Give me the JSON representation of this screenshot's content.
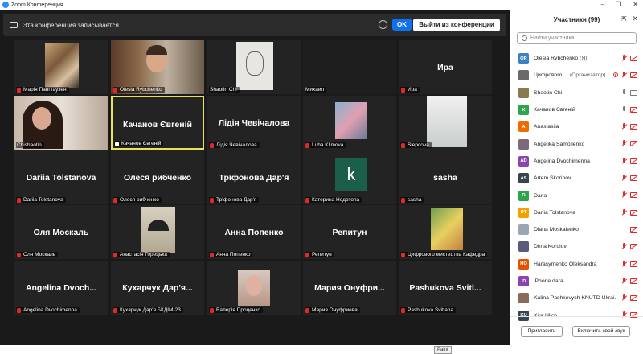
{
  "window": {
    "title": "Zoom Конференция",
    "minimize": "–",
    "restore": "❐",
    "close": "✕"
  },
  "recording_bar": {
    "message": "Эта конференция записывается.",
    "info_icon": "i",
    "ok_label": "OK",
    "leave_label": "Выйти из конференции"
  },
  "tiles": [
    {
      "caption": "Марія Пангтаузен",
      "big": "",
      "mic": "muted",
      "video": "photo-colorful"
    },
    {
      "caption": "Olesia Rybchenko",
      "big": "",
      "mic": "muted",
      "video": "woman-shelf"
    },
    {
      "caption": "Shaotin Chi",
      "big": "",
      "mic": "none",
      "video": "sketch"
    },
    {
      "caption": "Михаил",
      "big": "",
      "mic": "none",
      "video": "dark"
    },
    {
      "caption": "Ира",
      "big": "Ира",
      "mic": "muted",
      "video": ""
    },
    {
      "caption": "Chishaotin",
      "big": "",
      "mic": "none",
      "video": "woman-bright"
    },
    {
      "caption": "Качанов Євгеній",
      "big": "Качанов Євгеній",
      "mic": "on",
      "video": "",
      "active": true
    },
    {
      "caption": "Лідія Чевічалова",
      "big": "Лідія Чевічалова",
      "mic": "muted",
      "video": ""
    },
    {
      "caption": "Luba Klimova",
      "big": "",
      "mic": "muted",
      "video": "cartoon"
    },
    {
      "caption": "Slepcova",
      "big": "",
      "mic": "muted",
      "video": "light-panel"
    },
    {
      "caption": "Dariia Tolstanova",
      "big": "Dariia Tolstanova",
      "mic": "muted",
      "video": ""
    },
    {
      "caption": "Олеся рибченко",
      "big": "Олеся рибченко",
      "mic": "muted",
      "video": ""
    },
    {
      "caption": "Трїфонова Дар'я",
      "big": "Трїфонова Дар'я",
      "mic": "muted",
      "video": ""
    },
    {
      "caption": "Катерина Недотопа",
      "big": "",
      "mic": "muted",
      "video": "k-avatar",
      "avatar_letter": "k"
    },
    {
      "caption": "sasha",
      "big": "sasha",
      "mic": "muted",
      "video": ""
    },
    {
      "caption": "Оля Москаль",
      "big": "Оля Москаль",
      "mic": "muted",
      "video": ""
    },
    {
      "caption": "Анастасія Горецька",
      "big": "",
      "mic": "muted",
      "video": "photo-umbrella"
    },
    {
      "caption": "Анна Попенко",
      "big": "Анна Попенко",
      "mic": "muted",
      "video": ""
    },
    {
      "caption": "Репитун",
      "big": "Репитун",
      "mic": "muted",
      "video": ""
    },
    {
      "caption": "Цифрового мистецтва Кафедра",
      "big": "",
      "mic": "muted",
      "video": "photo-phone"
    },
    {
      "caption": "Angelina Dvochimenna",
      "big": "Angelina Dvoch...",
      "mic": "muted",
      "video": ""
    },
    {
      "caption": "Кухарчук Дар'я БКДІМ-23",
      "big": "Кухарчук Дар'я...",
      "mic": "muted",
      "video": ""
    },
    {
      "caption": "Валерія Проценко",
      "big": "",
      "mic": "muted",
      "video": "photo-portrait"
    },
    {
      "caption": "Мария Онуфриева",
      "big": "Мария Онуфри...",
      "mic": "muted",
      "video": ""
    },
    {
      "caption": "Pashukova Svitlana",
      "big": "Pashukova Svitl...",
      "mic": "muted",
      "video": ""
    }
  ],
  "paint_tooltip": "Paint",
  "panel": {
    "title": "Участники (99)",
    "popout_icon": "⇱",
    "close_icon": "✕",
    "search_placeholder": "Найти участника",
    "participants": [
      {
        "initials": "OR",
        "color": "#3b82c4",
        "name": "Olesia Rybchenko",
        "sub": " (Я)",
        "icons": [
          "mic-r",
          "cam-r"
        ]
      },
      {
        "initials": "",
        "color": "#6a6a6a",
        "name": "Цифрового ...",
        "sub": " (Организатор)",
        "icons": [
          "rec",
          "mic-r",
          "cam-r"
        ]
      },
      {
        "initials": "",
        "color": "#8a7a50",
        "name": "Shaotin Chi",
        "sub": "",
        "icons": [
          "mic-g",
          "cam-g"
        ]
      },
      {
        "initials": "K",
        "color": "#2ea44f",
        "name": "Качанов Євгеній",
        "sub": "",
        "icons": [
          "mic-g",
          "cam-r"
        ]
      },
      {
        "initials": "A",
        "color": "#ef6c00",
        "name": "Anastasiia",
        "sub": "",
        "icons": [
          "mic-r",
          "cam-r"
        ]
      },
      {
        "initials": "",
        "color": "#7a6a7a",
        "name": "Angelika Samoilenko",
        "sub": "",
        "icons": [
          "mic-r",
          "cam-r"
        ]
      },
      {
        "initials": "AD",
        "color": "#8e44ad",
        "name": "Angelina Dvochimenna",
        "sub": "",
        "icons": [
          "mic-r",
          "cam-r"
        ]
      },
      {
        "initials": "AS",
        "color": "#37474f",
        "name": "Artem Skorinov",
        "sub": "",
        "icons": [
          "mic-r",
          "cam-r"
        ]
      },
      {
        "initials": "D",
        "color": "#2ea44f",
        "name": "Daria",
        "sub": "",
        "icons": [
          "mic-r",
          "cam-r"
        ]
      },
      {
        "initials": "DT",
        "color": "#f4a100",
        "name": "Dariia Tolstanova",
        "sub": "",
        "icons": [
          "mic-r",
          "cam-r"
        ]
      },
      {
        "initials": "",
        "color": "#9aa6b2",
        "name": "Diana Moskalenko",
        "sub": "",
        "icons": [
          "cam-r"
        ]
      },
      {
        "initials": "",
        "color": "#5a5a7a",
        "name": "Dima Korolov",
        "sub": "",
        "icons": [
          "mic-r",
          "cam-r"
        ]
      },
      {
        "initials": "HO",
        "color": "#e65100",
        "name": "Harasymenko Oleksandra",
        "sub": "",
        "icons": [
          "mic-r",
          "cam-r"
        ]
      },
      {
        "initials": "ID",
        "color": "#8e44ad",
        "name": "iPhone dara",
        "sub": "",
        "icons": [
          "mic-r",
          "cam-r"
        ]
      },
      {
        "initials": "",
        "color": "#8a6a5a",
        "name": "Kalina Pashkevych KNUTD Ukrai...",
        "sub": "",
        "icons": [
          "mic-r",
          "cam-r"
        ]
      },
      {
        "initials": "KU",
        "color": "#37474f",
        "name": "Kira Ulich",
        "sub": "",
        "icons": [
          "mic-r",
          "cam-r"
        ]
      }
    ],
    "invite_label": "Пригласить",
    "unmute_label": "Включить свой звук"
  }
}
